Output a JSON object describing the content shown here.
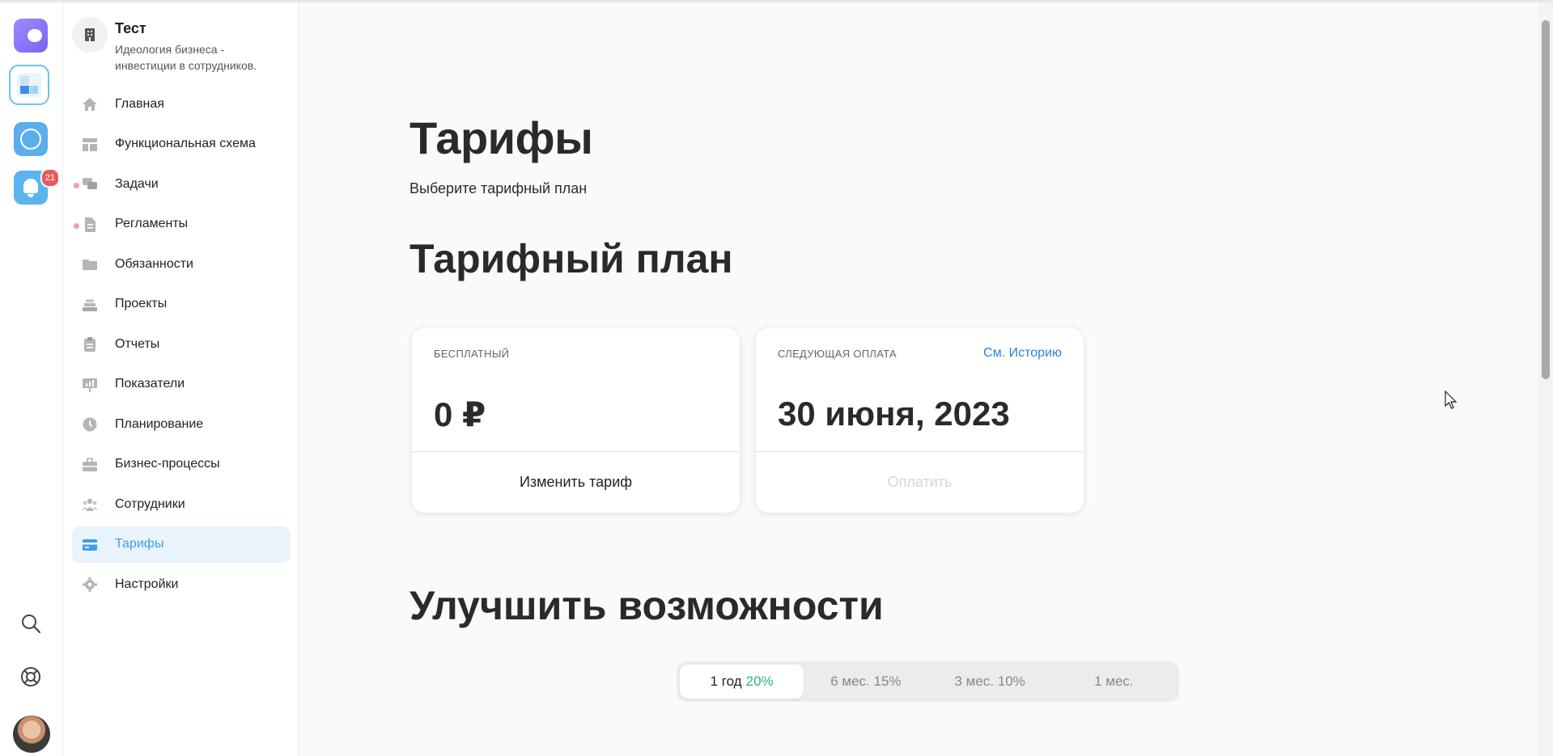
{
  "rail": {
    "notifications_count": "21",
    "colors": {
      "app1": "#8a76f5",
      "app_blue": "#5aaeec",
      "badge": "#e85a5a"
    }
  },
  "sidebar": {
    "org_name": "Тест",
    "org_desc": "Идеология бизнеса - инвестиции в сотрудников.",
    "items": [
      {
        "label": "Главная",
        "icon": "home-icon"
      },
      {
        "label": "Функциональная схема",
        "icon": "layout-icon"
      },
      {
        "label": "Задачи",
        "icon": "chat-icon",
        "dot": true
      },
      {
        "label": "Регламенты",
        "icon": "document-icon",
        "dot": true
      },
      {
        "label": "Обязанности",
        "icon": "folder-icon"
      },
      {
        "label": "Проекты",
        "icon": "stack-icon"
      },
      {
        "label": "Отчеты",
        "icon": "clipboard-icon"
      },
      {
        "label": "Показатели",
        "icon": "chart-icon"
      },
      {
        "label": "Планирование",
        "icon": "clock-icon"
      },
      {
        "label": "Бизнес-процессы",
        "icon": "briefcase-icon"
      },
      {
        "label": "Сотрудники",
        "icon": "people-icon"
      },
      {
        "label": "Тарифы",
        "icon": "card-icon",
        "active": true
      },
      {
        "label": "Настройки",
        "icon": "gear-icon"
      }
    ]
  },
  "main": {
    "title": "Тарифы",
    "subtitle": "Выберите тарифный план",
    "plan_section_title": "Тарифный план",
    "current_plan": {
      "caption": "БЕСПЛАТНЫЙ",
      "price": "0 ₽",
      "action": "Изменить тариф"
    },
    "next_payment": {
      "caption": "СЛЕДУЮЩАЯ ОПЛАТА",
      "history_link": "См. Историю",
      "date": "30 июня, 2023",
      "action": "Оплатить"
    },
    "upgrade_title": "Улучшить возможности",
    "periods": [
      {
        "label": "1 год",
        "discount": "20%",
        "selected": true
      },
      {
        "label": "6 мес. 15%"
      },
      {
        "label": "3 мес. 10%"
      },
      {
        "label": "1 мес."
      }
    ],
    "colors": {
      "accent": "#3ea0e6",
      "link": "#2f7fd0",
      "discount": "#2db37e"
    }
  }
}
